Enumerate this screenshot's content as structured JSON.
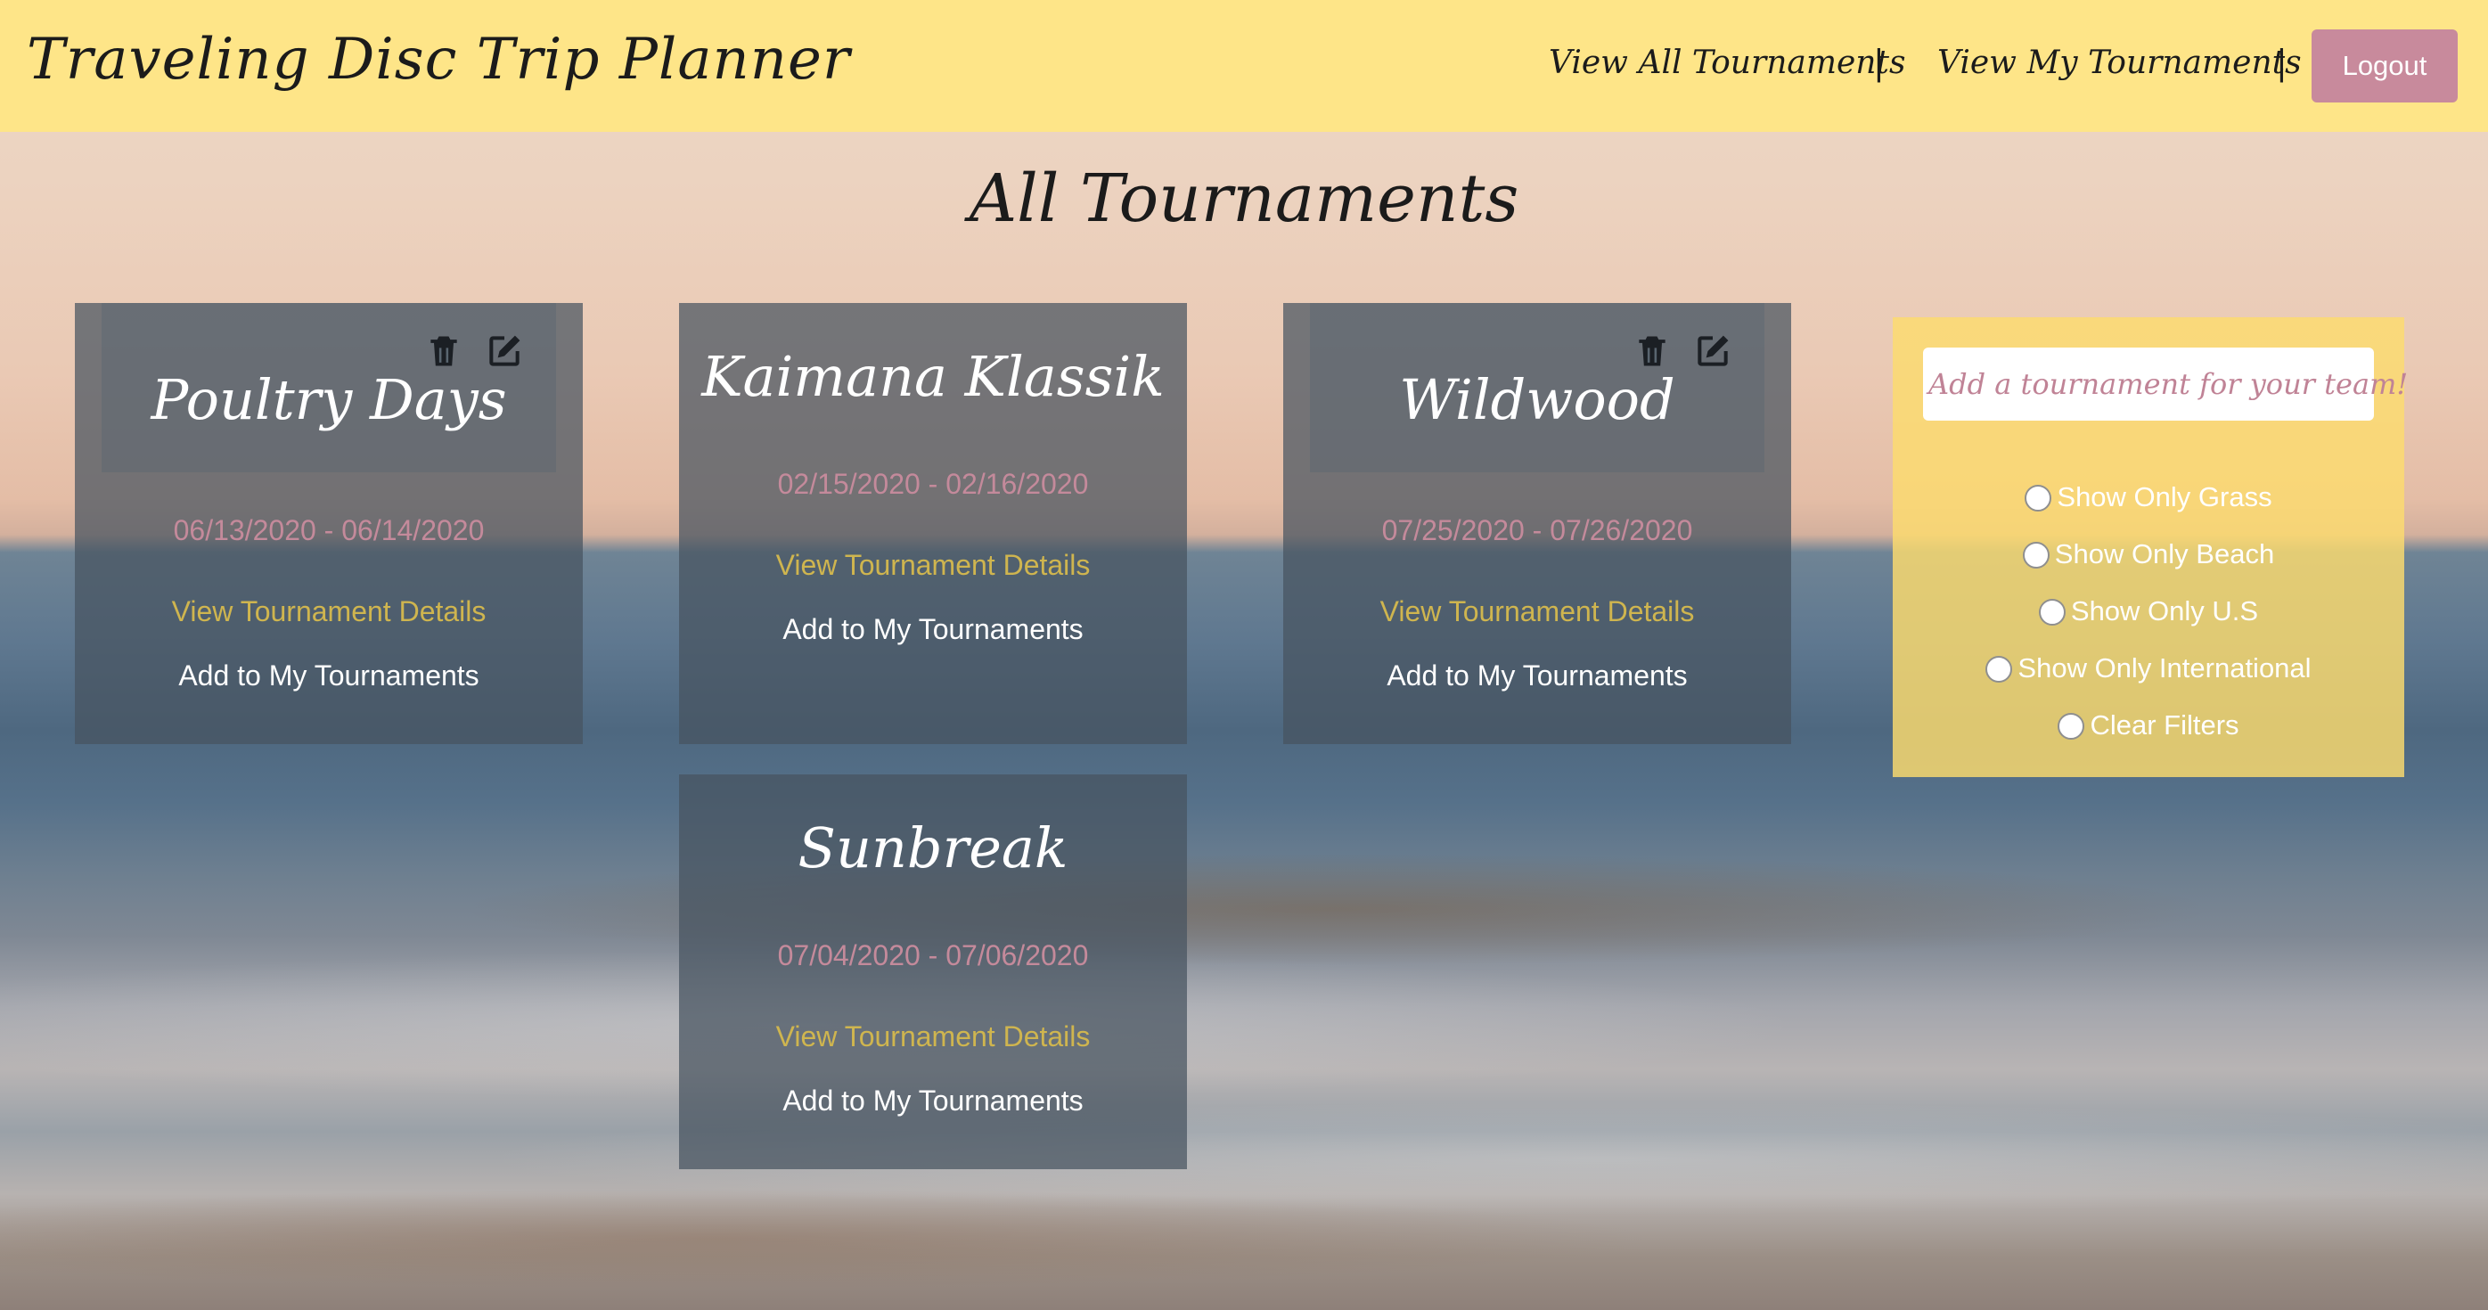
{
  "app": {
    "title": "Traveling Disc Trip Planner"
  },
  "nav": {
    "all_tournaments": "View All Tournaments",
    "separator": "|",
    "my_tournaments": "View My Tournaments",
    "logout": "Logout"
  },
  "page": {
    "heading": "All Tournaments"
  },
  "tournaments": [
    {
      "name": "Poultry Days",
      "dates": "06/13/2020 - 06/14/2020",
      "details_link": "View Tournament Details",
      "add_link": "Add to My Tournaments",
      "editable": true
    },
    {
      "name": "Kaimana Klassik",
      "dates": "02/15/2020 - 02/16/2020",
      "details_link": "View Tournament Details",
      "add_link": "Add to My Tournaments",
      "editable": false
    },
    {
      "name": "Wildwood",
      "dates": "07/25/2020 - 07/26/2020",
      "details_link": "View Tournament Details",
      "add_link": "Add to My Tournaments",
      "editable": true
    },
    {
      "name": "Sunbreak",
      "dates": "07/04/2020 - 07/06/2020",
      "details_link": "View Tournament Details",
      "add_link": "Add to My Tournaments",
      "editable": false
    }
  ],
  "filters": {
    "add_button": "Add a tournament for your team!",
    "options": [
      "Show Only Grass",
      "Show Only Beach",
      "Show Only U.S",
      "Show Only International",
      "Clear Filters"
    ]
  },
  "icons": {
    "delete": "trash-icon",
    "edit": "edit-icon"
  },
  "colors": {
    "topbar": "#fee588",
    "logout_button": "#c88a9c",
    "card_bg": "#465360",
    "date_text": "#c48a9b",
    "details_link": "#cfb54f",
    "filter_panel": "#fddc6e",
    "add_button_text": "#c08396"
  }
}
